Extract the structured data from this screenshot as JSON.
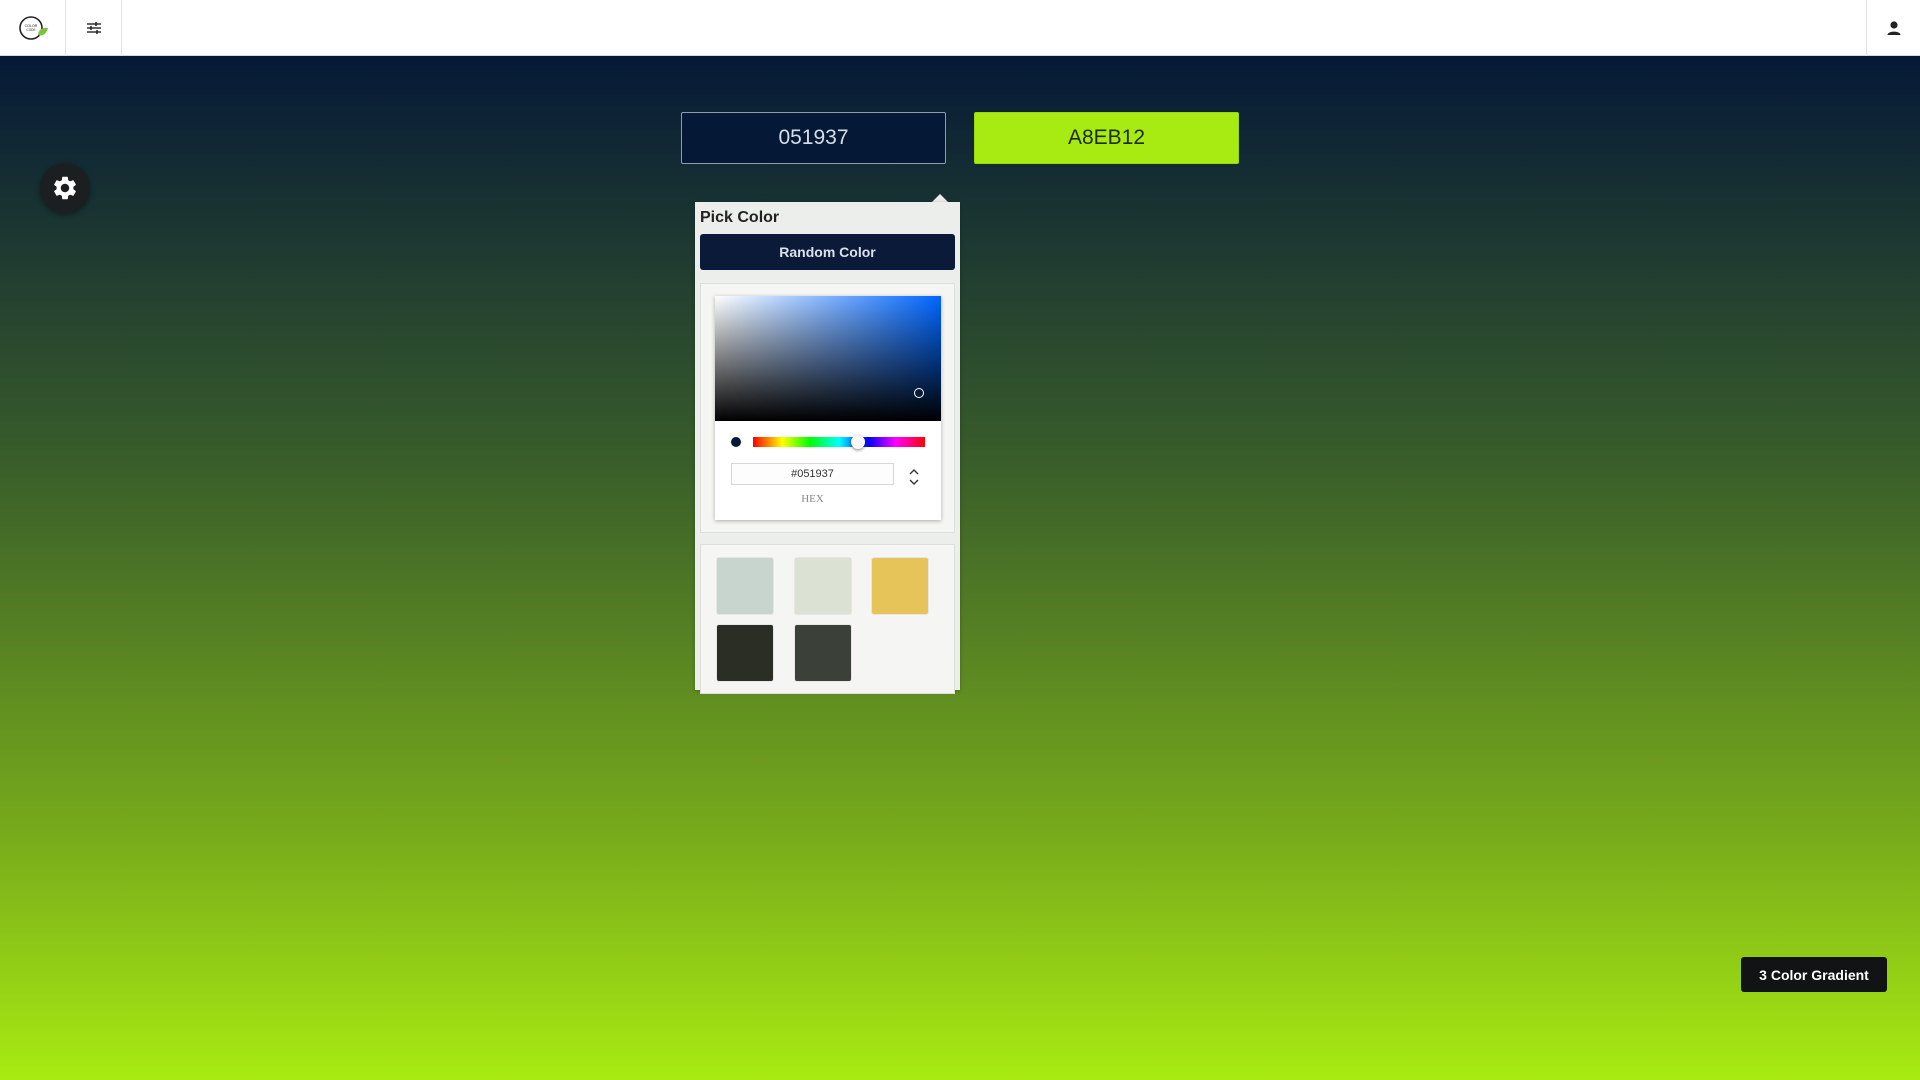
{
  "topbar": {
    "logo_icon": "color-leaf-logo-icon",
    "menu_icon": "sliders-icon",
    "user_icon": "user-icon"
  },
  "gradient": {
    "color_1": "#051937",
    "color_2": "#a8eb12"
  },
  "inputs": {
    "color_1_value": "051937",
    "color_2_value": "A8EB12"
  },
  "picker": {
    "title": "Pick Color",
    "random_label": "Random Color",
    "hex_value": "#051937",
    "mode_label": "HEX",
    "swatches": [
      "#c8d4ce",
      "#dbe1d3",
      "#e6c45a",
      "#2b2e25",
      "#3b4139"
    ]
  },
  "settings": {
    "icon": "gear-icon"
  },
  "actions": {
    "gradient_mode_label": "3 Color Gradient"
  }
}
